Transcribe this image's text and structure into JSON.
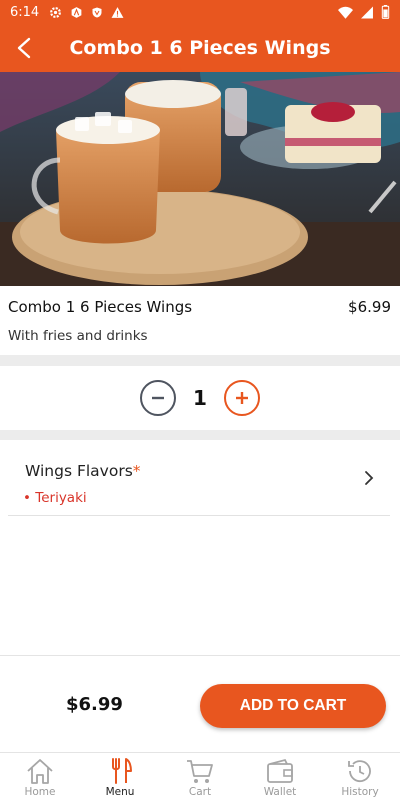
{
  "status_bar": {
    "time": "6:14"
  },
  "header": {
    "title": "Combo 1 6 Pieces Wings"
  },
  "product": {
    "name": "Combo 1 6 Pieces Wings",
    "price": "$6.99",
    "description": "With fries and drinks"
  },
  "quantity": {
    "value": "1"
  },
  "options": {
    "flavor_label": "Wings Flavors",
    "required_mark": "*",
    "selected": "• Teriyaki"
  },
  "checkout": {
    "total": "$6.99",
    "add_to_cart_label": "ADD TO CART"
  },
  "nav": {
    "items": [
      {
        "label": "Home",
        "icon": "home-icon"
      },
      {
        "label": "Menu",
        "icon": "fork-knife-icon"
      },
      {
        "label": "Cart",
        "icon": "cart-icon"
      },
      {
        "label": "Wallet",
        "icon": "wallet-icon"
      },
      {
        "label": "History",
        "icon": "history-icon"
      }
    ],
    "active": "Menu"
  },
  "colors": {
    "accent": "#e8561f",
    "required": "#e8561f",
    "selected_option": "#d9352a"
  }
}
